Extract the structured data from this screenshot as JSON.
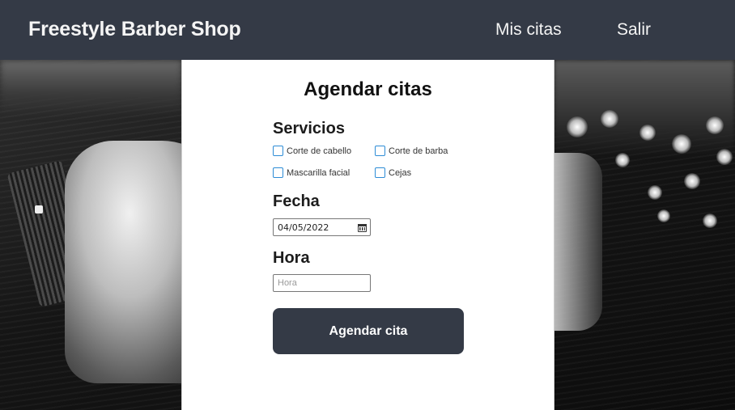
{
  "header": {
    "brand": "Freestyle Barber Shop",
    "nav": [
      {
        "label": "Mis citas"
      },
      {
        "label": "Salir"
      }
    ]
  },
  "form": {
    "title": "Agendar citas",
    "servicios_label": "Servicios",
    "servicios": [
      {
        "label": "Corte de cabello",
        "checked": false
      },
      {
        "label": "Corte de barba",
        "checked": false
      },
      {
        "label": "Mascarilla facial",
        "checked": false
      },
      {
        "label": "Cejas",
        "checked": false
      }
    ],
    "fecha_label": "Fecha",
    "fecha_value": "04/05/2022",
    "hora_label": "Hora",
    "hora_value": "",
    "hora_placeholder": "Hora",
    "submit_label": "Agendar cita"
  },
  "colors": {
    "header_bg": "#343a46",
    "button_bg": "#343a46",
    "checkbox_border": "#2d8cd6",
    "card_bg": "#ffffff"
  },
  "icons": {
    "calendar": "calendar-icon"
  }
}
